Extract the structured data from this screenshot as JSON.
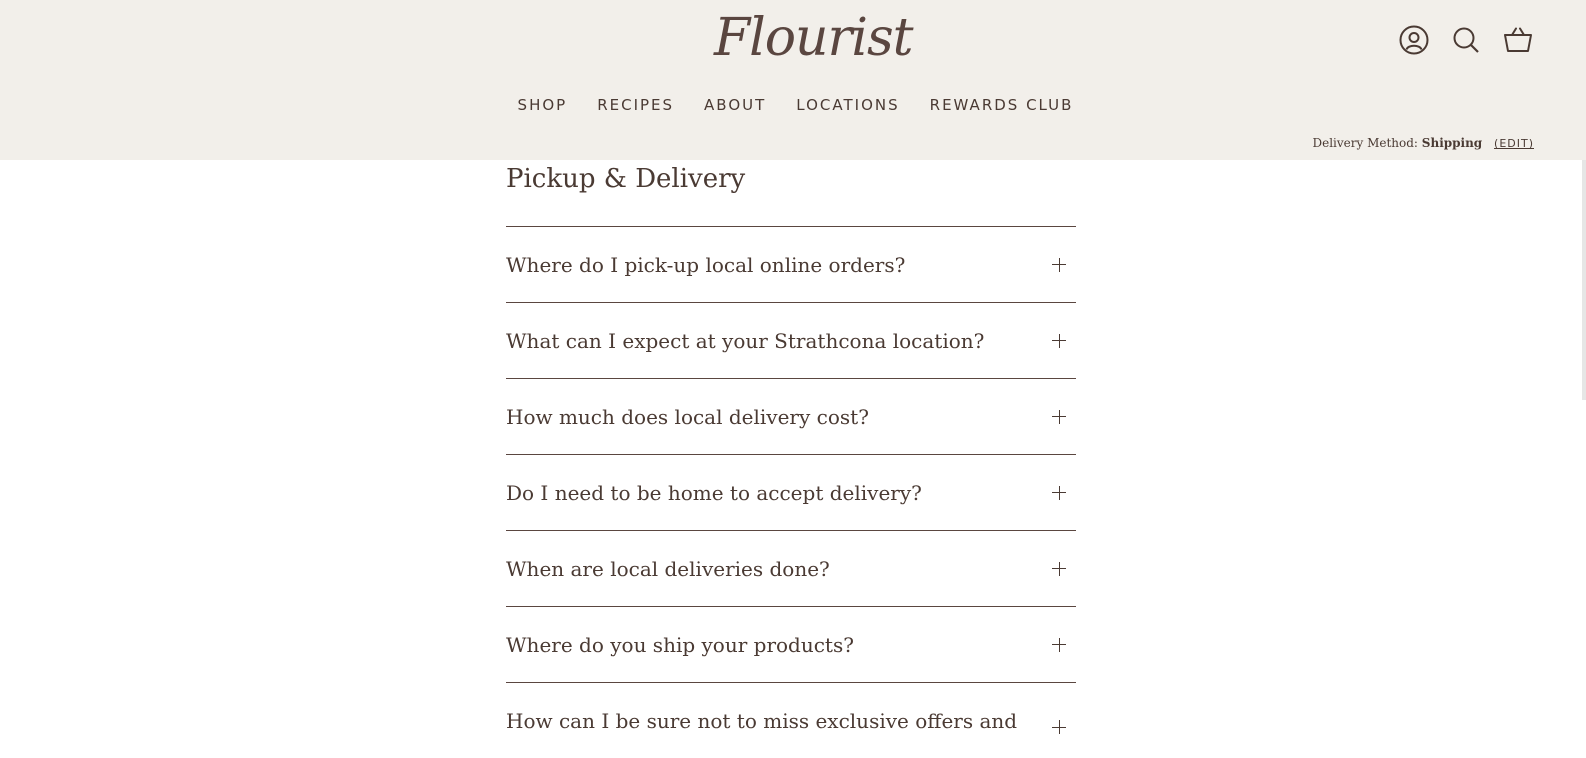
{
  "header": {
    "logo": "Flourist",
    "icons": [
      "account-icon",
      "search-icon",
      "cart-icon"
    ]
  },
  "nav": {
    "items": [
      "SHOP",
      "RECIPES",
      "ABOUT",
      "LOCATIONS",
      "REWARDS CLUB"
    ]
  },
  "delivery": {
    "label": "Delivery Method:",
    "method": "Shipping",
    "edit": "(EDIT)"
  },
  "section": {
    "title": "Pickup & Delivery"
  },
  "faq": [
    {
      "question": "Where do I pick-up local online orders?"
    },
    {
      "question": "What can I expect at your Strathcona location?"
    },
    {
      "question": "How much does local delivery cost?"
    },
    {
      "question": "Do I need to be home to accept delivery?"
    },
    {
      "question": "When are local deliveries done?"
    },
    {
      "question": "Where do you ship your products?"
    },
    {
      "question": "How can I be sure not to miss exclusive offers and"
    }
  ],
  "colors": {
    "header_bg": "#f2efea",
    "text": "#4a3a33"
  }
}
